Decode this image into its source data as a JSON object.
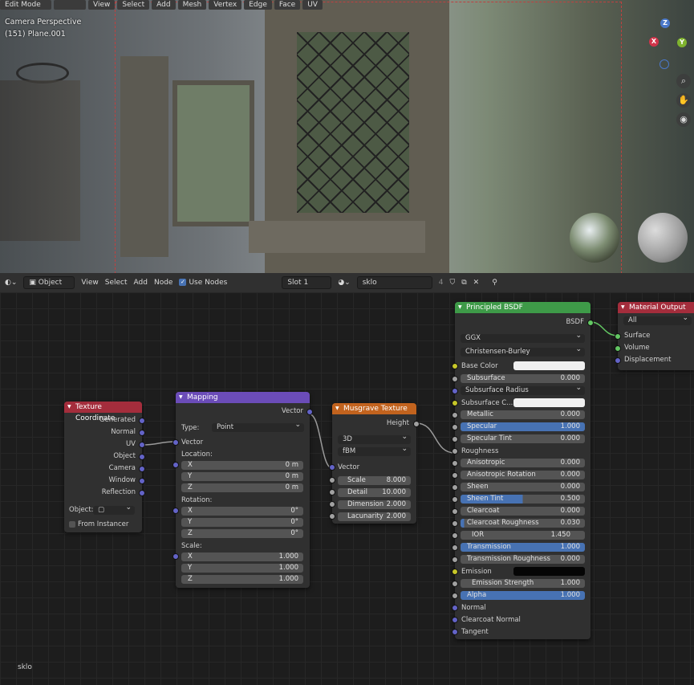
{
  "viewport": {
    "mode_label": "Edit Mode",
    "menu": [
      "View",
      "Select",
      "Add",
      "Mesh",
      "Vertex",
      "Edge",
      "Face",
      "UV"
    ],
    "info_line1": "Camera Perspective",
    "info_line2": "(151) Plane.001",
    "gizmo": {
      "z": "Z",
      "x": "X",
      "y": "Y"
    }
  },
  "node_header": {
    "editor_type": "Object",
    "menu": [
      "View",
      "Select",
      "Add",
      "Node"
    ],
    "use_nodes_label": "Use Nodes",
    "slot": "Slot 1",
    "material": "sklo",
    "users": "4"
  },
  "nodes": {
    "texcoord": {
      "title": "Texture Coordinate",
      "outputs": [
        "Generated",
        "Normal",
        "UV",
        "Object",
        "Camera",
        "Window",
        "Reflection"
      ],
      "object_label": "Object:",
      "from_instancer": "From Instancer"
    },
    "mapping": {
      "title": "Mapping",
      "output": "Vector",
      "type_label": "Type:",
      "type_value": "Point",
      "input_vector": "Vector",
      "location_label": "Location:",
      "location": [
        {
          "axis": "X",
          "value": "0 m"
        },
        {
          "axis": "Y",
          "value": "0 m"
        },
        {
          "axis": "Z",
          "value": "0 m"
        }
      ],
      "rotation_label": "Rotation:",
      "rotation": [
        {
          "axis": "X",
          "value": "0°"
        },
        {
          "axis": "Y",
          "value": "0°"
        },
        {
          "axis": "Z",
          "value": "0°"
        }
      ],
      "scale_label": "Scale:",
      "scale": [
        {
          "axis": "X",
          "value": "1.000"
        },
        {
          "axis": "Y",
          "value": "1.000"
        },
        {
          "axis": "Z",
          "value": "1.000"
        }
      ]
    },
    "musgrave": {
      "title": "Musgrave Texture",
      "output": "Height",
      "dim": "3D",
      "type": "fBM",
      "input_vector": "Vector",
      "fields": [
        {
          "label": "Scale",
          "value": "8.000"
        },
        {
          "label": "Detail",
          "value": "10.000"
        },
        {
          "label": "Dimension",
          "value": "2.000"
        },
        {
          "label": "Lacunarity",
          "value": "2.000"
        }
      ]
    },
    "bsdf": {
      "title": "Principled BSDF",
      "output": "BSDF",
      "distribution": "GGX",
      "subsurface_method": "Christensen-Burley",
      "base_color": "Base Color",
      "subsurface": {
        "label": "Subsurface",
        "value": "0.000"
      },
      "subsurface_radius": "Subsurface Radius",
      "subsurface_color": "Subsurface C...",
      "metallic": {
        "label": "Metallic",
        "value": "0.000"
      },
      "specular": {
        "label": "Specular",
        "value": "1.000"
      },
      "specular_tint": {
        "label": "Specular Tint",
        "value": "0.000"
      },
      "roughness": "Roughness",
      "anisotropic": {
        "label": "Anisotropic",
        "value": "0.000"
      },
      "anisotropic_rotation": {
        "label": "Anisotropic Rotation",
        "value": "0.000"
      },
      "sheen": {
        "label": "Sheen",
        "value": "0.000"
      },
      "sheen_tint": {
        "label": "Sheen Tint",
        "value": "0.500"
      },
      "clearcoat": {
        "label": "Clearcoat",
        "value": "0.000"
      },
      "clearcoat_roughness": {
        "label": "Clearcoat Roughness",
        "value": "0.030"
      },
      "ior": {
        "label": "IOR",
        "value": "1.450"
      },
      "transmission": {
        "label": "Transmission",
        "value": "1.000"
      },
      "transmission_roughness": {
        "label": "Transmission Roughness",
        "value": "0.000"
      },
      "emission": "Emission",
      "emission_strength": {
        "label": "Emission Strength",
        "value": "1.000"
      },
      "alpha": {
        "label": "Alpha",
        "value": "1.000"
      },
      "normal": "Normal",
      "clearcoat_normal": "Clearcoat Normal",
      "tangent": "Tangent"
    },
    "output": {
      "title": "Material Output",
      "target": "All",
      "inputs": [
        "Surface",
        "Volume",
        "Displacement"
      ]
    }
  },
  "footer_label": "sklo",
  "colors": {
    "texcoord_header": "#a42d3c",
    "mapping_header": "#6b4cb8",
    "musgrave_header": "#c2631e",
    "bsdf_header": "#3e9a48",
    "output_header": "#a42d3c",
    "accent": "#4772b3"
  }
}
